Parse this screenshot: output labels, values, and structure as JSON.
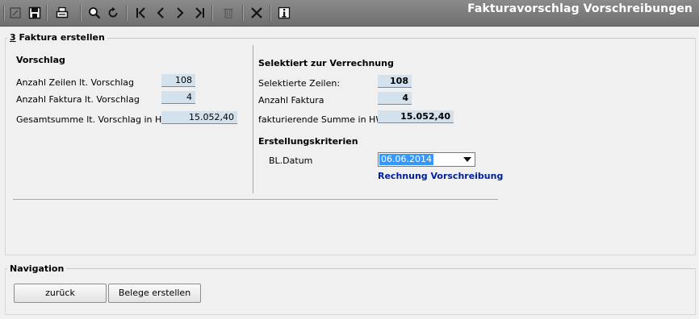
{
  "window": {
    "title": "Fakturavorschlag Vorschreibungen"
  },
  "toolbar": {
    "icons": [
      "edit-icon",
      "save-icon",
      "print-icon",
      "search-icon",
      "refresh-icon",
      "first-record-icon",
      "previous-record-icon",
      "next-record-icon",
      "last-record-icon",
      "delete-icon",
      "close-icon",
      "info-icon"
    ]
  },
  "faktura": {
    "legend_num": "3",
    "legend_text": " Faktura erstellen",
    "vorschlag": {
      "header": "Vorschlag",
      "rows": [
        {
          "label": "Anzahl Zeilen lt. Vorschlag",
          "value": "108"
        },
        {
          "label": "Anzahl Faktura lt. Vorschlag",
          "value": "4"
        },
        {
          "label": "Gesamtsumme lt. Vorschlag in HW:",
          "value": "15.052,40"
        }
      ]
    },
    "selektiert": {
      "header": "Selektiert zur Verrechnung",
      "rows": [
        {
          "label": "Selektierte Zeilen:",
          "value": "108"
        },
        {
          "label": "Anzahl Faktura",
          "value": "4"
        },
        {
          "label": "fakturierende Summe in HW",
          "value": "15.052,40"
        }
      ]
    },
    "kriterien": {
      "header": "Erstellungskriterien",
      "bl_datum_label": "BL.Datum",
      "bl_datum_value": "06.06.2014",
      "link": "Rechnung Vorschreibung"
    }
  },
  "navigation": {
    "legend": "Navigation",
    "back_label": "zurück",
    "create_label": "Belege erstellen"
  }
}
